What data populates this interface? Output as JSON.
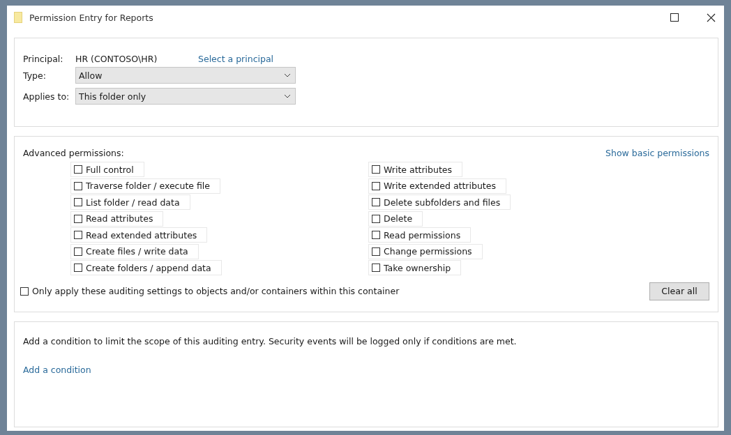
{
  "window": {
    "title": "Permission Entry for Reports"
  },
  "principal": {
    "label": "Principal:",
    "value": "HR (CONTOSO\\HR)",
    "link": "Select a principal"
  },
  "type": {
    "label": "Type:",
    "value": "Allow"
  },
  "applies_to": {
    "label": "Applies to:",
    "value": "This folder only"
  },
  "advanced": {
    "label": "Advanced permissions:",
    "link": "Show basic permissions",
    "left": [
      {
        "label": "Full control",
        "checked": false
      },
      {
        "label": "Traverse folder / execute file",
        "checked": false
      },
      {
        "label": "List folder / read data",
        "checked": false
      },
      {
        "label": "Read attributes",
        "checked": false
      },
      {
        "label": "Read extended attributes",
        "checked": false
      },
      {
        "label": "Create files / write data",
        "checked": false
      },
      {
        "label": "Create folders / append data",
        "checked": false
      }
    ],
    "right": [
      {
        "label": "Write attributes",
        "checked": false
      },
      {
        "label": "Write extended attributes",
        "checked": false
      },
      {
        "label": "Delete subfolders and files",
        "checked": false
      },
      {
        "label": "Delete",
        "checked": false
      },
      {
        "label": "Read permissions",
        "checked": false
      },
      {
        "label": "Change permissions",
        "checked": false
      },
      {
        "label": "Take ownership",
        "checked": false
      }
    ],
    "only_apply": {
      "label": "Only apply these auditing settings to objects and/or containers within this container",
      "checked": false
    },
    "clear_button": "Clear all"
  },
  "condition": {
    "text": "Add a condition to limit the scope of this auditing entry. Security events will be logged only if conditions are met.",
    "link": "Add a condition"
  }
}
